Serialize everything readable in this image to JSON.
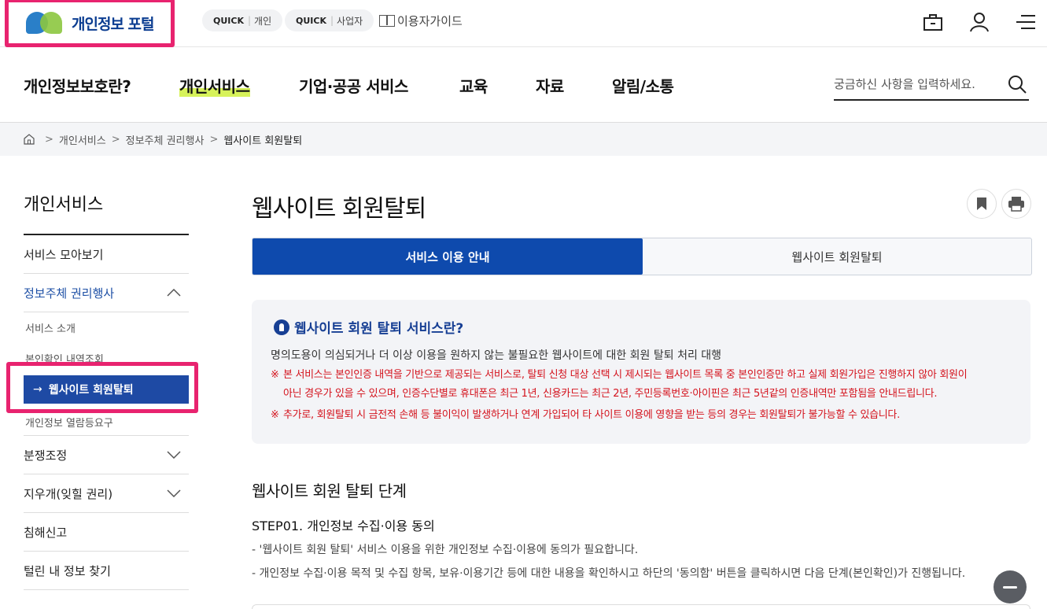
{
  "header": {
    "logo_text": "개인정보 포털",
    "quick_personal": {
      "tag": "QUICK",
      "label": "개인"
    },
    "quick_business": {
      "tag": "QUICK",
      "label": "사업자"
    },
    "guide_label": "이용자가이드",
    "icons": [
      "briefcase-icon",
      "user-icon",
      "hamburger-menu-icon"
    ]
  },
  "nav": {
    "items": [
      "개인정보보호란?",
      "개인서비스",
      "기업·공공 서비스",
      "교육",
      "자료",
      "알림/소통"
    ],
    "active": "개인서비스",
    "search_placeholder": "궁금하신 사항을 입력하세요."
  },
  "breadcrumb": {
    "items": [
      "개인서비스",
      "정보주체 권리행사",
      "웹사이트 회원탈퇴"
    ]
  },
  "sidebar": {
    "title": "개인서비스",
    "items": [
      {
        "label": "서비스 모아보기"
      },
      {
        "label": "정보주체 권리행사",
        "expanded": true
      },
      {
        "label": "분쟁조정",
        "expandable": true
      },
      {
        "label": "지우개(잊힐 권리)",
        "expandable": true
      },
      {
        "label": "침해신고"
      },
      {
        "label": "털린 내 정보 찾기"
      }
    ],
    "sub_items": [
      "서비스 소개",
      "본인확인 내역조회",
      "웹사이트 회원탈퇴",
      "개인정보 열람등요구"
    ],
    "active_sub": "웹사이트 회원탈퇴",
    "active_arrow": "→"
  },
  "content": {
    "title": "웹사이트 회원탈퇴",
    "tabs": [
      "서비스 이용 안내",
      "웹사이트 회원탈퇴"
    ],
    "info": {
      "heading": "웹사이트 회원 탈퇴 서비스란?",
      "description": "명의도용이 의심되거나 더 이상 이용을 원하지 않는 불필요한 웹사이트에 대한 회원 탈퇴 처리 대행",
      "note_mark": "※",
      "note1_line1": "본 서비스는 본인인증 내역을 기반으로 제공되는 서비스로, 탈퇴 신청 대상 선택 시 제시되는 웹사이트 목록 중 본인인증만 하고 실제 회원가입은 진행하지 않아 회원이",
      "note1_line2": "아닌 경우가 있을 수 있으며, 인증수단별로 휴대폰은 최근 1년, 신용카드는 최근 2년, 주민등록번호·아이핀은 최근 5년같의 인증내역만 포함됨을 안내드립니다.",
      "note2": "추가로, 회원탈퇴 시 금전적 손해 등 불이익이 발생하거나 연계 가입되어 타 사이트 이용에 영향을 받는 등의 경우는 회원탈퇴가 불가능할 수 있습니다."
    },
    "steps_heading": "웹사이트 회원 탈퇴 단계",
    "step1_title": "STEP01. 개인정보 수집·이용 동의",
    "step1_lines": [
      "- '웹사이트 회원 탈퇴' 서비스 이용을 위한 개인정보 수집·이용에 동의가 필요합니다.",
      "- 개인정보 수집·이용 목적 및 수집 항목, 보유·이용기간 등에 대한 내용을 확인하시고 하단의 '동의함' 버튼을 클릭하시면 다음 단계(본인확인)가 진행됩니다."
    ]
  },
  "colors": {
    "primary": "#0e4aad",
    "highlight": "#e8236f",
    "nav_underline": "#d7f25a",
    "warning": "#d4121c"
  }
}
